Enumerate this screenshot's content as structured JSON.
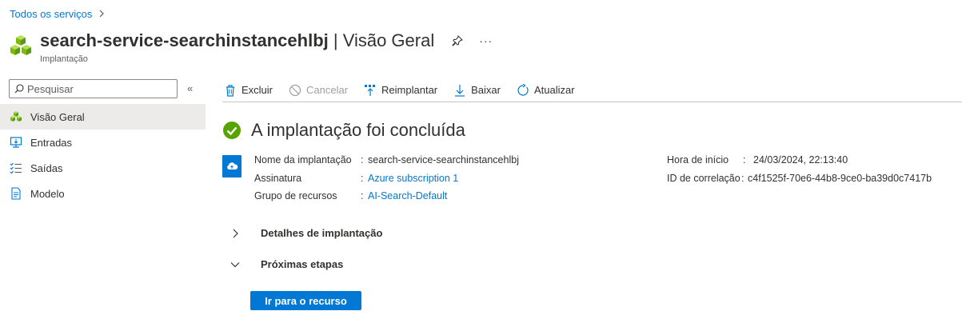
{
  "breadcrumb": {
    "root": "Todos os serviços"
  },
  "header": {
    "title_bold": "search-service-searchinstancehlbj",
    "title_rest": " | Visão Geral",
    "subtitle": "Implantação",
    "more_label": "···"
  },
  "search": {
    "placeholder": "Pesquisar"
  },
  "collapse_label": "«",
  "nav": {
    "items": [
      {
        "label": "Visão Geral",
        "icon": "overview-icon",
        "active": true
      },
      {
        "label": "Entradas",
        "icon": "inputs-icon"
      },
      {
        "label": "Saídas",
        "icon": "outputs-icon"
      },
      {
        "label": "Modelo",
        "icon": "template-icon"
      }
    ]
  },
  "toolbar": {
    "delete": "Excluir",
    "cancel": "Cancelar",
    "redeploy": "Reimplantar",
    "download": "Baixar",
    "refresh": "Atualizar"
  },
  "status": {
    "text": "A implantação foi concluída",
    "color": "#57a300"
  },
  "details": {
    "deployment_name_label": "Nome da implantação",
    "deployment_name": "search-service-searchinstancehlbj",
    "subscription_label": "Assinatura",
    "subscription": "Azure subscription 1",
    "resource_group_label": "Grupo de recursos",
    "resource_group": "AI-Search-Default",
    "start_time_label": "Hora de início",
    "start_time": "24/03/2024, 22:13:40",
    "correlation_label": "ID de correlação",
    "correlation_id": "c4f1525f-70e6-44b8-9ce0-ba39d0c7417b",
    "separator": ":"
  },
  "sections": {
    "deployment_details": "Detalhes de implantação",
    "next_steps": "Próximas etapas"
  },
  "go_to_resource": "Ir para o recurso",
  "colors": {
    "accent": "#0078d4",
    "success": "#57a300",
    "resource_green": "#7fba00"
  }
}
